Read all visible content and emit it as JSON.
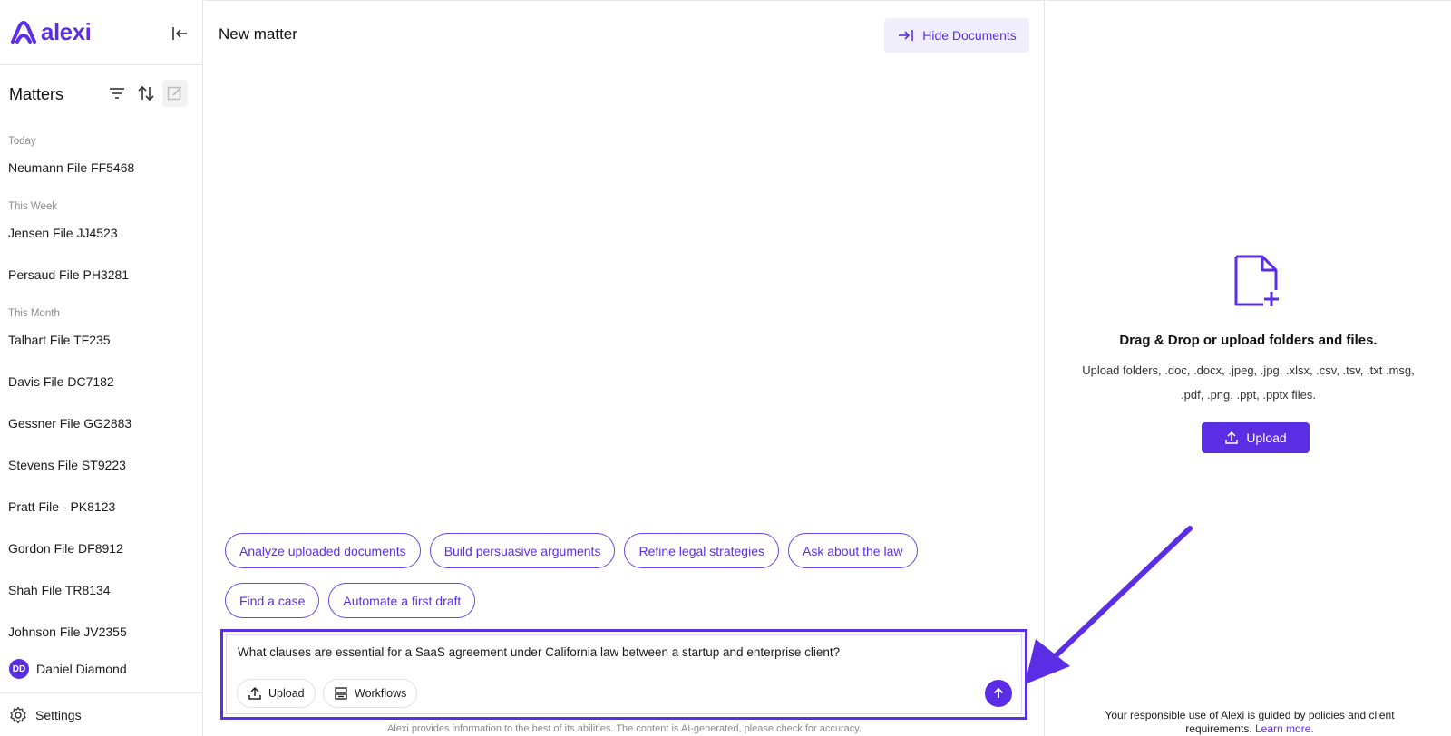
{
  "brand": {
    "name": "alexi",
    "accent": "#5b2ee6"
  },
  "sidebar": {
    "title": "Matters",
    "groups": [
      {
        "label": "Today",
        "items": [
          "Neumann File FF5468"
        ]
      },
      {
        "label": "This Week",
        "items": [
          "Jensen File JJ4523",
          "Persaud File PH3281"
        ]
      },
      {
        "label": "This Month",
        "items": [
          "Talhart File TF235",
          "Davis File DC7182",
          "Gessner File GG2883",
          "Stevens File ST9223",
          "Pratt File - PK8123",
          "Gordon File DF8912",
          "Shah File TR8134",
          "Johnson File JV2355"
        ]
      }
    ],
    "user": {
      "initials": "DD",
      "name": "Daniel Diamond"
    },
    "settings_label": "Settings"
  },
  "main": {
    "title": "New matter",
    "hide_documents_label": "Hide Documents",
    "suggestions_row1": [
      "Analyze uploaded documents",
      "Build persuasive arguments",
      "Refine legal strategies",
      "Ask about the law"
    ],
    "suggestions_row2": [
      "Find a case",
      "Automate a first draft"
    ],
    "composer": {
      "text": "What clauses are essential for a SaaS agreement under California law between a startup and enterprise client?",
      "upload_label": "Upload",
      "workflows_label": "Workflows"
    },
    "disclaimer": "Alexi provides information to the best of its abilities. The content is AI-generated, please check for accuracy."
  },
  "documents": {
    "drop_title": "Drag & Drop or upload folders and files.",
    "drop_subtitle": "Upload folders, .doc, .docx, .jpeg, .jpg, .xlsx, .csv, .tsv, .txt .msg, .pdf, .png, .ppt, .pptx files.",
    "upload_label": "Upload",
    "policy_text": "Your responsible use of Alexi is guided by policies and client requirements.",
    "policy_link": "Learn more."
  }
}
